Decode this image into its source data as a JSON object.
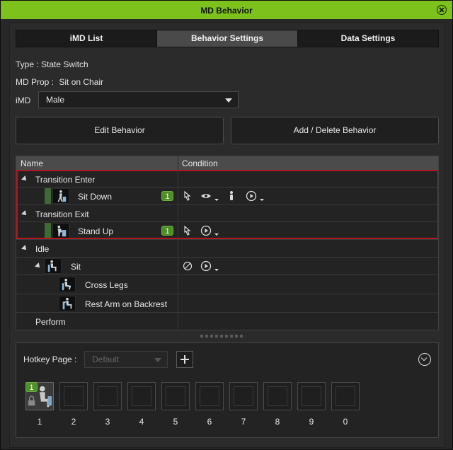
{
  "window": {
    "title": "MD Behavior"
  },
  "tabs": [
    {
      "label": "iMD List",
      "active": false
    },
    {
      "label": "Behavior Settings",
      "active": true
    },
    {
      "label": "Data Settings",
      "active": false
    }
  ],
  "info": {
    "type_label": "Type :",
    "type_value": "State Switch",
    "prop_label": "MD Prop :",
    "prop_value": "Sit on Chair",
    "imd_label": "iMD",
    "imd_value": "Male"
  },
  "buttons": {
    "edit": "Edit Behavior",
    "add_delete": "Add / Delete Behavior"
  },
  "tree": {
    "col_name": "Name",
    "col_condition": "Condition",
    "rows": [
      {
        "label": "Transition Enter",
        "kind": "group"
      },
      {
        "label": "Sit Down",
        "kind": "item",
        "badge": "1",
        "conditions": [
          "hand-pointer-icon",
          "eye-icon",
          "person-icon",
          "play-icon"
        ]
      },
      {
        "label": "Transition Exit",
        "kind": "group"
      },
      {
        "label": "Stand Up",
        "kind": "item",
        "badge": "1",
        "conditions": [
          "hand-pointer-icon",
          "play-icon"
        ]
      },
      {
        "label": "Idle",
        "kind": "group"
      },
      {
        "label": "Sit",
        "kind": "subgroup",
        "conditions": [
          "no-icon",
          "play-icon"
        ]
      },
      {
        "label": "Cross Legs",
        "kind": "leaf"
      },
      {
        "label": "Rest Arm on Backrest",
        "kind": "leaf"
      },
      {
        "label": "Perform",
        "kind": "group"
      }
    ]
  },
  "hotkey": {
    "label": "Hotkey Page :",
    "page_value": "Default",
    "slot_badge": "1",
    "slots": [
      "1",
      "2",
      "3",
      "4",
      "5",
      "6",
      "7",
      "8",
      "9",
      "0"
    ]
  },
  "colors": {
    "accent": "#7cc11c",
    "highlight_border": "#b1171d",
    "badge": "#4f8f2a"
  }
}
